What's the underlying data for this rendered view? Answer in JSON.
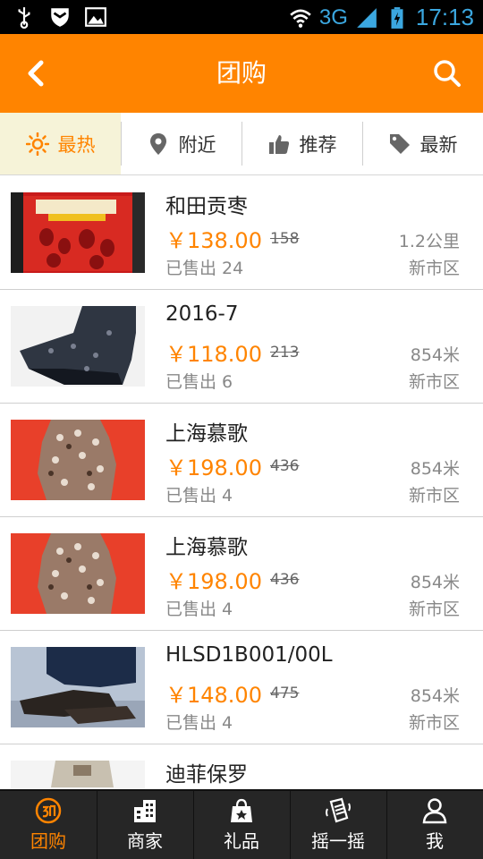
{
  "status_bar": {
    "network": "3G",
    "time": "17:13",
    "icons": [
      "usb-icon",
      "shield-icon",
      "image-icon",
      "wifi-icon",
      "signal-icon",
      "battery-icon"
    ]
  },
  "header": {
    "title": "团购",
    "back_icon": "chevron-left-icon",
    "search_icon": "search-icon"
  },
  "tabs": [
    {
      "label": "最热",
      "icon": "sun-icon",
      "active": true
    },
    {
      "label": "附近",
      "icon": "location-pin-icon",
      "active": false
    },
    {
      "label": "推荐",
      "icon": "thumbs-up-icon",
      "active": false
    },
    {
      "label": "最新",
      "icon": "tag-icon",
      "active": false
    }
  ],
  "items": [
    {
      "name": "和田贡枣",
      "price": "￥138.00",
      "original": "158",
      "sold": "已售出 24",
      "distance": "1.2公里",
      "area": "新市区"
    },
    {
      "name": "2016-7",
      "price": "￥118.00",
      "original": "213",
      "sold": "已售出 6",
      "distance": "854米",
      "area": "新市区"
    },
    {
      "name": "上海慕歌",
      "price": "￥198.00",
      "original": "436",
      "sold": "已售出 4",
      "distance": "854米",
      "area": "新市区"
    },
    {
      "name": "上海慕歌",
      "price": "￥198.00",
      "original": "436",
      "sold": "已售出 4",
      "distance": "854米",
      "area": "新市区"
    },
    {
      "name": "HLSD1B001/00L",
      "price": "￥148.00",
      "original": "475",
      "sold": "已售出 4",
      "distance": "854米",
      "area": "新市区"
    },
    {
      "name": "迪菲保罗",
      "price": "",
      "original": "",
      "sold": "",
      "distance": "",
      "area": ""
    }
  ],
  "bottom_nav": [
    {
      "label": "团购",
      "icon": "group-buy-icon",
      "active": true
    },
    {
      "label": "商家",
      "icon": "building-icon",
      "active": false
    },
    {
      "label": "礼品",
      "icon": "gift-bag-icon",
      "active": false
    },
    {
      "label": "摇一摇",
      "icon": "shake-hand-icon",
      "active": false
    },
    {
      "label": "我",
      "icon": "user-icon",
      "active": false
    }
  ],
  "colors": {
    "accent": "#ff8400",
    "header_bg": "#ff8400",
    "active_tab_bg": "#f6f3d8",
    "nav_bg": "#262626",
    "status_text": "#3ba7e0"
  }
}
